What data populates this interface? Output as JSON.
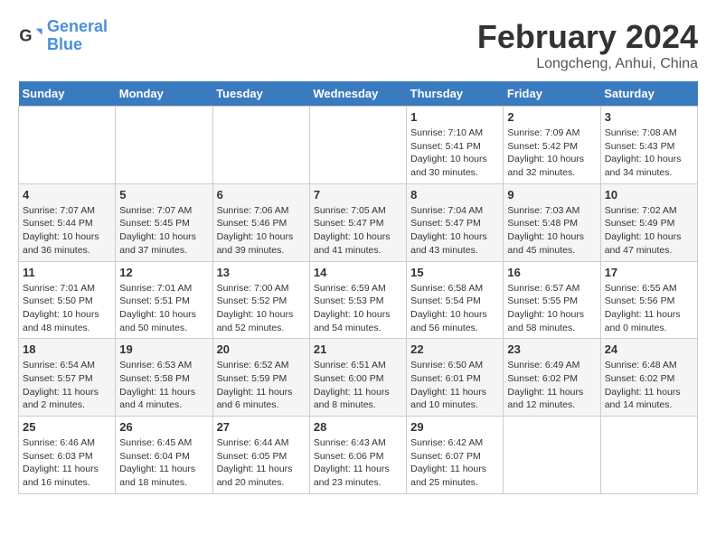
{
  "header": {
    "logo_line1": "General",
    "logo_line2": "Blue",
    "title": "February 2024",
    "subtitle": "Longcheng, Anhui, China"
  },
  "days_of_week": [
    "Sunday",
    "Monday",
    "Tuesday",
    "Wednesday",
    "Thursday",
    "Friday",
    "Saturday"
  ],
  "weeks": [
    [
      {
        "day": "",
        "info": ""
      },
      {
        "day": "",
        "info": ""
      },
      {
        "day": "",
        "info": ""
      },
      {
        "day": "",
        "info": ""
      },
      {
        "day": "1",
        "info": "Sunrise: 7:10 AM\nSunset: 5:41 PM\nDaylight: 10 hours\nand 30 minutes."
      },
      {
        "day": "2",
        "info": "Sunrise: 7:09 AM\nSunset: 5:42 PM\nDaylight: 10 hours\nand 32 minutes."
      },
      {
        "day": "3",
        "info": "Sunrise: 7:08 AM\nSunset: 5:43 PM\nDaylight: 10 hours\nand 34 minutes."
      }
    ],
    [
      {
        "day": "4",
        "info": "Sunrise: 7:07 AM\nSunset: 5:44 PM\nDaylight: 10 hours\nand 36 minutes."
      },
      {
        "day": "5",
        "info": "Sunrise: 7:07 AM\nSunset: 5:45 PM\nDaylight: 10 hours\nand 37 minutes."
      },
      {
        "day": "6",
        "info": "Sunrise: 7:06 AM\nSunset: 5:46 PM\nDaylight: 10 hours\nand 39 minutes."
      },
      {
        "day": "7",
        "info": "Sunrise: 7:05 AM\nSunset: 5:47 PM\nDaylight: 10 hours\nand 41 minutes."
      },
      {
        "day": "8",
        "info": "Sunrise: 7:04 AM\nSunset: 5:47 PM\nDaylight: 10 hours\nand 43 minutes."
      },
      {
        "day": "9",
        "info": "Sunrise: 7:03 AM\nSunset: 5:48 PM\nDaylight: 10 hours\nand 45 minutes."
      },
      {
        "day": "10",
        "info": "Sunrise: 7:02 AM\nSunset: 5:49 PM\nDaylight: 10 hours\nand 47 minutes."
      }
    ],
    [
      {
        "day": "11",
        "info": "Sunrise: 7:01 AM\nSunset: 5:50 PM\nDaylight: 10 hours\nand 48 minutes."
      },
      {
        "day": "12",
        "info": "Sunrise: 7:01 AM\nSunset: 5:51 PM\nDaylight: 10 hours\nand 50 minutes."
      },
      {
        "day": "13",
        "info": "Sunrise: 7:00 AM\nSunset: 5:52 PM\nDaylight: 10 hours\nand 52 minutes."
      },
      {
        "day": "14",
        "info": "Sunrise: 6:59 AM\nSunset: 5:53 PM\nDaylight: 10 hours\nand 54 minutes."
      },
      {
        "day": "15",
        "info": "Sunrise: 6:58 AM\nSunset: 5:54 PM\nDaylight: 10 hours\nand 56 minutes."
      },
      {
        "day": "16",
        "info": "Sunrise: 6:57 AM\nSunset: 5:55 PM\nDaylight: 10 hours\nand 58 minutes."
      },
      {
        "day": "17",
        "info": "Sunrise: 6:55 AM\nSunset: 5:56 PM\nDaylight: 11 hours\nand 0 minutes."
      }
    ],
    [
      {
        "day": "18",
        "info": "Sunrise: 6:54 AM\nSunset: 5:57 PM\nDaylight: 11 hours\nand 2 minutes."
      },
      {
        "day": "19",
        "info": "Sunrise: 6:53 AM\nSunset: 5:58 PM\nDaylight: 11 hours\nand 4 minutes."
      },
      {
        "day": "20",
        "info": "Sunrise: 6:52 AM\nSunset: 5:59 PM\nDaylight: 11 hours\nand 6 minutes."
      },
      {
        "day": "21",
        "info": "Sunrise: 6:51 AM\nSunset: 6:00 PM\nDaylight: 11 hours\nand 8 minutes."
      },
      {
        "day": "22",
        "info": "Sunrise: 6:50 AM\nSunset: 6:01 PM\nDaylight: 11 hours\nand 10 minutes."
      },
      {
        "day": "23",
        "info": "Sunrise: 6:49 AM\nSunset: 6:02 PM\nDaylight: 11 hours\nand 12 minutes."
      },
      {
        "day": "24",
        "info": "Sunrise: 6:48 AM\nSunset: 6:02 PM\nDaylight: 11 hours\nand 14 minutes."
      }
    ],
    [
      {
        "day": "25",
        "info": "Sunrise: 6:46 AM\nSunset: 6:03 PM\nDaylight: 11 hours\nand 16 minutes."
      },
      {
        "day": "26",
        "info": "Sunrise: 6:45 AM\nSunset: 6:04 PM\nDaylight: 11 hours\nand 18 minutes."
      },
      {
        "day": "27",
        "info": "Sunrise: 6:44 AM\nSunset: 6:05 PM\nDaylight: 11 hours\nand 20 minutes."
      },
      {
        "day": "28",
        "info": "Sunrise: 6:43 AM\nSunset: 6:06 PM\nDaylight: 11 hours\nand 23 minutes."
      },
      {
        "day": "29",
        "info": "Sunrise: 6:42 AM\nSunset: 6:07 PM\nDaylight: 11 hours\nand 25 minutes."
      },
      {
        "day": "",
        "info": ""
      },
      {
        "day": "",
        "info": ""
      }
    ]
  ]
}
